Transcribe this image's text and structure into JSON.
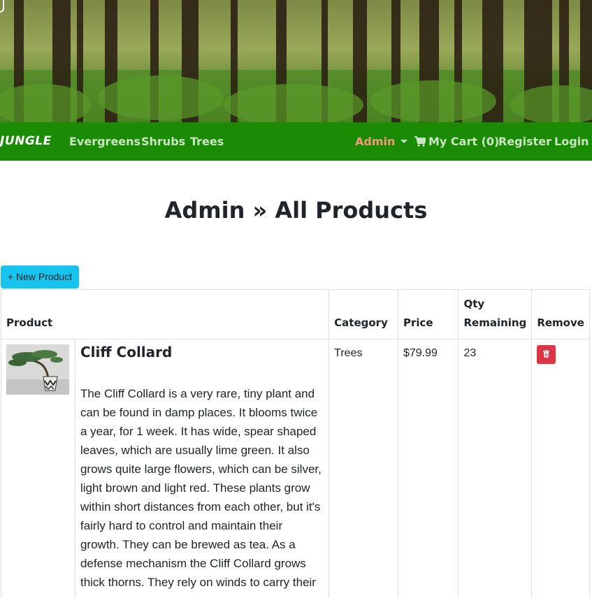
{
  "navbar": {
    "brand": "JUNGLE",
    "links": [
      "Evergreens",
      "Shrubs",
      "Trees"
    ],
    "admin_label": "Admin",
    "cart_label": "My Cart (0)",
    "register_label": "Register",
    "login_label": "Login"
  },
  "page": {
    "title": "Admin » All Products",
    "new_product_label": "+ New Product"
  },
  "table": {
    "headers": [
      "Product",
      "Category",
      "Price",
      "Qty Remaining",
      "Remove"
    ],
    "rows": [
      {
        "name": "Cliff Collard",
        "description": "The Cliff Collard is a very rare, tiny plant and can be found in damp places. It blooms twice a year, for 1 week. It has wide, spear shaped leaves, which are usually lime green. It also grows quite large flowers, which can be silver, light brown and light red. These plants grow within short distances from each other, but it's fairly hard to control and maintain their growth. They can be brewed as tea. As a defense mechanism the Cliff Collard grows thick thorns. They rely on winds to carry their",
        "category": "Trees",
        "price": "$79.99",
        "quantity": "23"
      }
    ]
  },
  "colors": {
    "navbar_bg": "#1b8a04",
    "new_button_bg": "#17c4ee",
    "remove_button_bg": "#dc3545",
    "admin_link": "#f29b7a"
  },
  "icons": [
    "cart-icon",
    "trash-icon",
    "forest-banner"
  ]
}
